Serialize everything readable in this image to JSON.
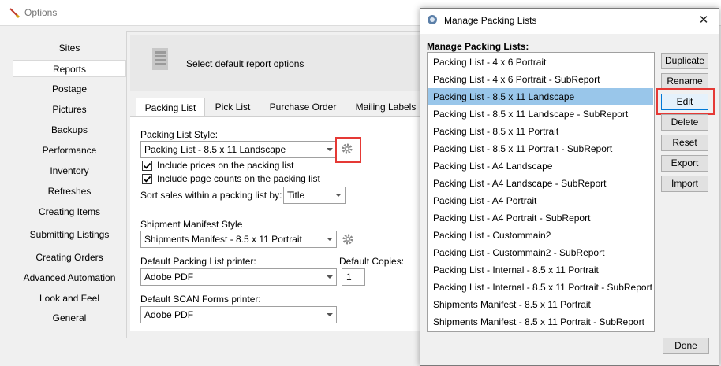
{
  "options_window": {
    "title": "Options",
    "nav_items": [
      {
        "label": "Sites",
        "selected": false
      },
      {
        "label": "Reports",
        "selected": true
      },
      {
        "label": "Postage",
        "selected": false
      },
      {
        "label": "Pictures",
        "selected": false
      },
      {
        "label": "Backups",
        "selected": false
      },
      {
        "label": "Performance",
        "selected": false
      },
      {
        "label": "Inventory",
        "selected": false
      },
      {
        "label": "Refreshes",
        "selected": false
      },
      {
        "label": "Creating Items",
        "selected": false
      },
      {
        "label": "Submitting Listings",
        "selected": false
      },
      {
        "label": "Creating Orders",
        "selected": false
      },
      {
        "label": "Advanced Automation",
        "selected": false
      },
      {
        "label": "Look and Feel",
        "selected": false
      },
      {
        "label": "General",
        "selected": false
      }
    ],
    "header_text": "Select default report options",
    "tabs": [
      {
        "label": "Packing List",
        "active": true
      },
      {
        "label": "Pick List",
        "active": false
      },
      {
        "label": "Purchase Order",
        "active": false
      },
      {
        "label": "Mailing Labels",
        "active": false
      }
    ],
    "packing_list_style": {
      "label": "Packing List Style:",
      "value": "Packing List - 8.5 x 11 Landscape"
    },
    "include_prices": {
      "label": "Include prices on the packing list",
      "checked": true
    },
    "include_page_counts": {
      "label": "Include page counts on the packing list",
      "checked": true
    },
    "sort_sales": {
      "label": "Sort sales within a packing list by:",
      "value": "Title"
    },
    "shipment_manifest_style": {
      "label": "Shipment Manifest Style",
      "value": "Shipments Manifest - 8.5 x 11 Portrait"
    },
    "default_packing_printer": {
      "label": "Default Packing List printer:",
      "value": "Adobe PDF"
    },
    "default_copies": {
      "label": "Default Copies:",
      "value": "1"
    },
    "default_scan_printer": {
      "label": "Default SCAN Forms printer:",
      "value": "Adobe PDF"
    }
  },
  "dialog": {
    "title": "Manage Packing Lists",
    "list_label": "Manage Packing Lists:",
    "items": [
      {
        "label": "Packing List - 4 x 6 Portrait",
        "selected": false
      },
      {
        "label": "Packing List - 4 x 6 Portrait - SubReport",
        "selected": false
      },
      {
        "label": "Packing List - 8.5 x 11 Landscape",
        "selected": true
      },
      {
        "label": "Packing List - 8.5 x 11 Landscape - SubReport",
        "selected": false
      },
      {
        "label": "Packing List - 8.5 x 11 Portrait",
        "selected": false
      },
      {
        "label": "Packing List - 8.5 x 11 Portrait - SubReport",
        "selected": false
      },
      {
        "label": "Packing List - A4 Landscape",
        "selected": false
      },
      {
        "label": "Packing List - A4 Landscape - SubReport",
        "selected": false
      },
      {
        "label": "Packing List - A4 Portrait",
        "selected": false
      },
      {
        "label": "Packing List - A4 Portrait - SubReport",
        "selected": false
      },
      {
        "label": "Packing List - Custommain2",
        "selected": false
      },
      {
        "label": "Packing List - Custommain2 - SubReport",
        "selected": false
      },
      {
        "label": "Packing List - Internal - 8.5 x 11 Portrait",
        "selected": false
      },
      {
        "label": "Packing List - Internal - 8.5 x 11 Portrait - SubReport",
        "selected": false
      },
      {
        "label": "Shipments Manifest - 8.5 x 11 Portrait",
        "selected": false
      },
      {
        "label": "Shipments Manifest - 8.5 x 11 Portrait - SubReport",
        "selected": false
      }
    ],
    "buttons": {
      "duplicate": "Duplicate",
      "rename": "Rename",
      "edit": "Edit",
      "delete": "Delete",
      "reset": "Reset",
      "export": "Export",
      "import": "Import",
      "done": "Done"
    }
  },
  "colors": {
    "selection": "#99c6ea",
    "highlight": "#e53935"
  }
}
